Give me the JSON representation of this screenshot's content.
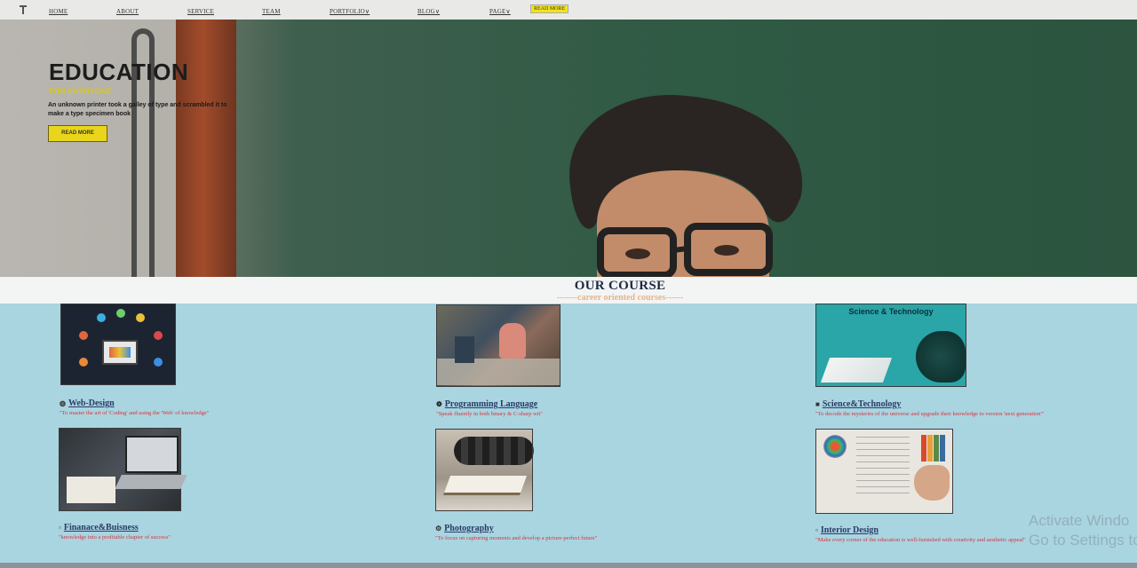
{
  "nav": {
    "items": [
      {
        "label": "HOME"
      },
      {
        "label": "ABOUT"
      },
      {
        "label": "SERVICE"
      },
      {
        "label": "TEAM"
      },
      {
        "label": "PORTFOLIO∨"
      },
      {
        "label": "BLOG∨"
      },
      {
        "label": "PAGE∨"
      }
    ],
    "cta": "READ MORE"
  },
  "hero": {
    "title": "EDUCATION",
    "subtitle": "FOR EVERYONE",
    "description": "An unknown printer took a galley of type and scrambled it to make a type specimen book",
    "button": "READ MORE"
  },
  "courses": {
    "title": "OUR COURSE",
    "subtitle": "-------career oriented courses------",
    "items": [
      {
        "icon": "globe-icon",
        "glyph": "◍",
        "title": "Web-Design",
        "desc": "\"To master the art of 'Coding' and using the 'Web' of knowledge\""
      },
      {
        "icon": "code-icon",
        "glyph": "❁",
        "title": "Programming Language",
        "desc": "\"Speak fluently in both binary & C-sharp wit\""
      },
      {
        "icon": "chat-icon",
        "glyph": "■",
        "title": "Science&Technology",
        "desc": "\"To decode the mysteries of the universe and upgrade their knowledge to version 'next generation'\""
      },
      {
        "icon": "chart-icon",
        "glyph": "▫",
        "title": "Finanace&Buisness",
        "desc": "\"knowledge into a profitable chapter of success\""
      },
      {
        "icon": "camera-icon",
        "glyph": "⚙",
        "title": "Photography",
        "desc": "\"To focus on capturing moments and develop a picture-perfect future\""
      },
      {
        "icon": "ruler-icon",
        "glyph": "▫",
        "title": "Interior Design",
        "desc": "\"Make every corner of the education is well-furnished with creativity and aesthetic appeal\""
      }
    ],
    "science_image_caption": "Science & Technology"
  },
  "watermark": {
    "line1": "Activate Windo",
    "line2": "Go to Settings to ac"
  },
  "colors": {
    "accent_yellow": "#e9d61c",
    "course_band": "#a9d5e1",
    "title_navy": "#2a3b66",
    "desc_red": "#d8333a"
  }
}
